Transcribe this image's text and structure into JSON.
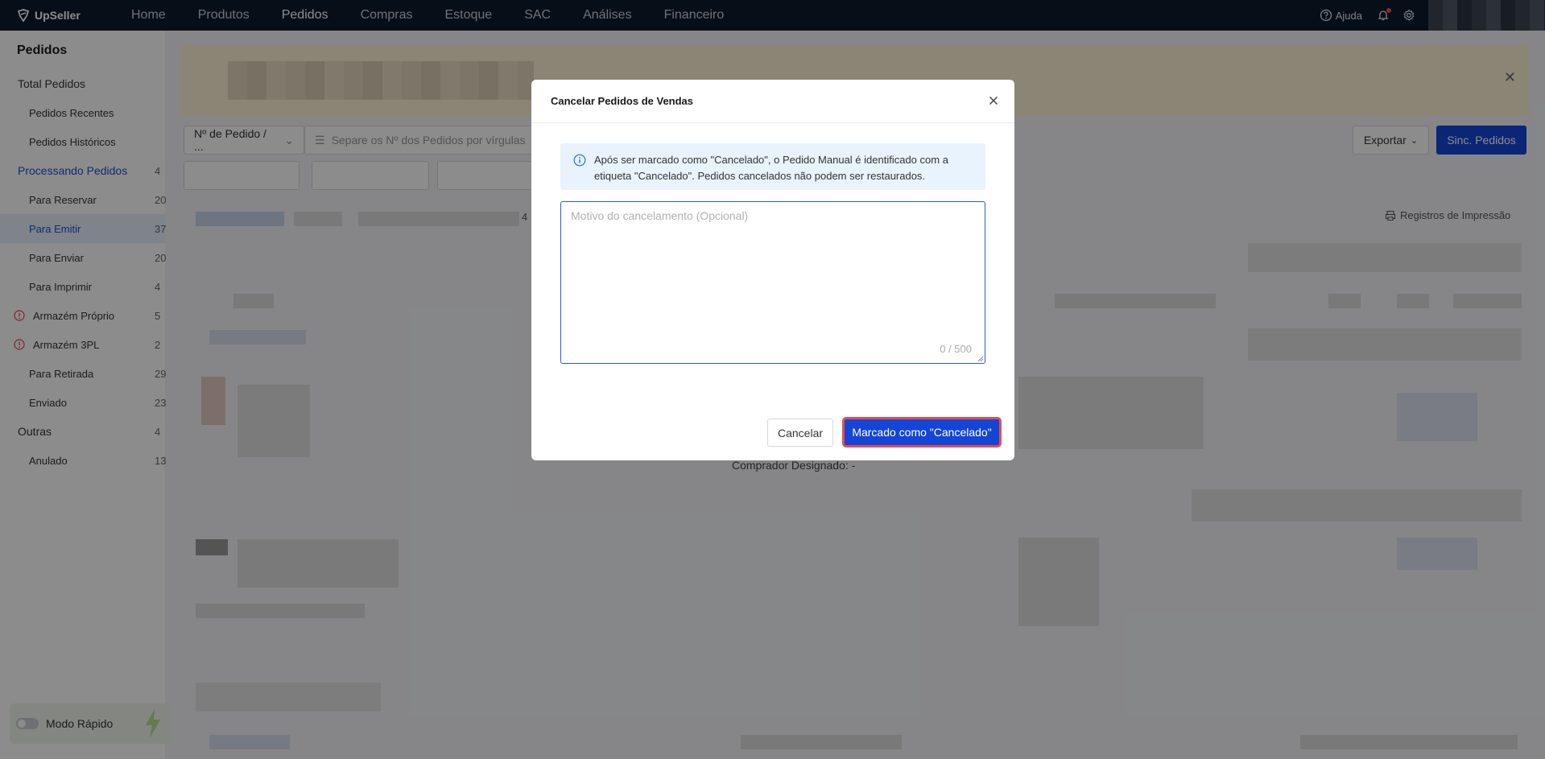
{
  "brand": {
    "name": "UpSeller"
  },
  "nav": {
    "items": [
      {
        "label": "Home"
      },
      {
        "label": "Produtos"
      },
      {
        "label": "Pedidos",
        "active": true
      },
      {
        "label": "Compras"
      },
      {
        "label": "Estoque"
      },
      {
        "label": "SAC"
      },
      {
        "label": "Análises"
      },
      {
        "label": "Financeiro"
      }
    ],
    "help_label": "Ajuda"
  },
  "sidebar": {
    "title": "Pedidos",
    "items": [
      {
        "label": "Total Pedidos",
        "count": ""
      },
      {
        "label": "Pedidos Recentes",
        "count": ""
      },
      {
        "label": "Pedidos Históricos",
        "count": ""
      },
      {
        "label": "Processando Pedidos",
        "count": "4"
      },
      {
        "label": "Para Reservar",
        "count": "20"
      },
      {
        "label": "Para Emitir",
        "count": "37"
      },
      {
        "label": "Para Enviar",
        "count": "20"
      },
      {
        "label": "Para Imprimir",
        "count": "4"
      },
      {
        "label": "Armazém Próprio",
        "count": "5"
      },
      {
        "label": "Armazém 3PL",
        "count": "2"
      },
      {
        "label": "Para Retirada",
        "count": "29"
      },
      {
        "label": "Enviado",
        "count": "23"
      },
      {
        "label": "Outras",
        "count": "4"
      },
      {
        "label": "Anulado",
        "count": "13"
      }
    ],
    "quick_mode_label": "Modo Rápido"
  },
  "main": {
    "order_filter_label": "Nº de Pedido / ...",
    "order_search_placeholder": "Separe os Nº dos Pedidos por vírgulas",
    "export_label": "Exportar",
    "sync_label": "Sinc. Pedidos",
    "print_records_label": "Registros de Impressão",
    "buyer_label": "Comprador Designado: -",
    "page_number": "4"
  },
  "modal": {
    "title": "Cancelar Pedidos de Vendas",
    "info_text": "Após ser marcado como \"Cancelado\", o Pedido Manual é identificado com a etiqueta \"Cancelado\". Pedidos cancelados não podem ser restaurados.",
    "reason_placeholder": "Motivo do cancelamento (Opcional)",
    "reason_value": "",
    "counter": "0 / 500",
    "cancel_label": "Cancelar",
    "confirm_label": "Marcado como \"Cancelado\""
  },
  "colors": {
    "topbar": "#0c1b2c",
    "primary": "#1445d6",
    "highlight_border": "#e05050",
    "info_bg": "#e9f3fe"
  }
}
